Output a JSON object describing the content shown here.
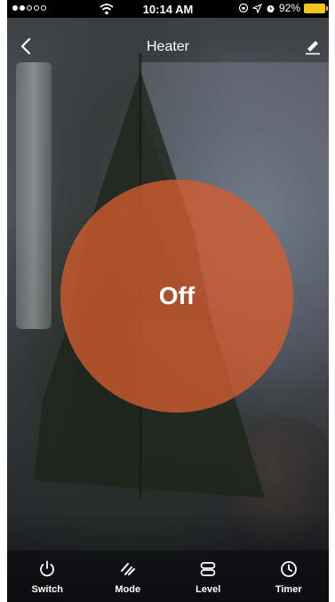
{
  "status_bar": {
    "time": "10:14 AM",
    "battery_text": "92%",
    "battery_color": "#f4c41a"
  },
  "header": {
    "title": "Heater"
  },
  "device": {
    "state": "Off",
    "circle_color": "#d55c30"
  },
  "toolbar": {
    "items": [
      {
        "label": "Switch",
        "icon": "power-icon"
      },
      {
        "label": "Mode",
        "icon": "mode-icon"
      },
      {
        "label": "Level",
        "icon": "level-icon"
      },
      {
        "label": "Timer",
        "icon": "clock-icon"
      }
    ]
  }
}
